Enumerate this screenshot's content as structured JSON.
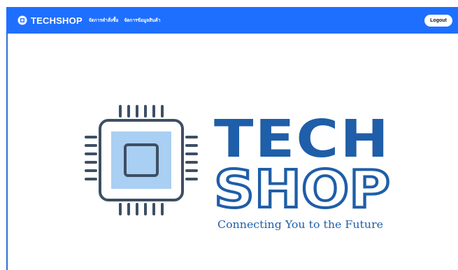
{
  "navbar": {
    "brand_icon": "chip-icon",
    "brand_name": "TECHSHOP",
    "links": [
      {
        "label": "จัดการคำสั่งซื้อ"
      },
      {
        "label": "จัดการข้อมูลสินค้า"
      }
    ],
    "logout_label": "Logout",
    "background_color": "#1f6fff"
  },
  "hero_logo": {
    "line1": "TECH",
    "line2": "SHOP",
    "tagline": "Connecting You to the Future",
    "primary_color": "#1f5ea8",
    "chip_fill_color": "#a9cff2",
    "chip_outline_color": "#3d4f63"
  }
}
